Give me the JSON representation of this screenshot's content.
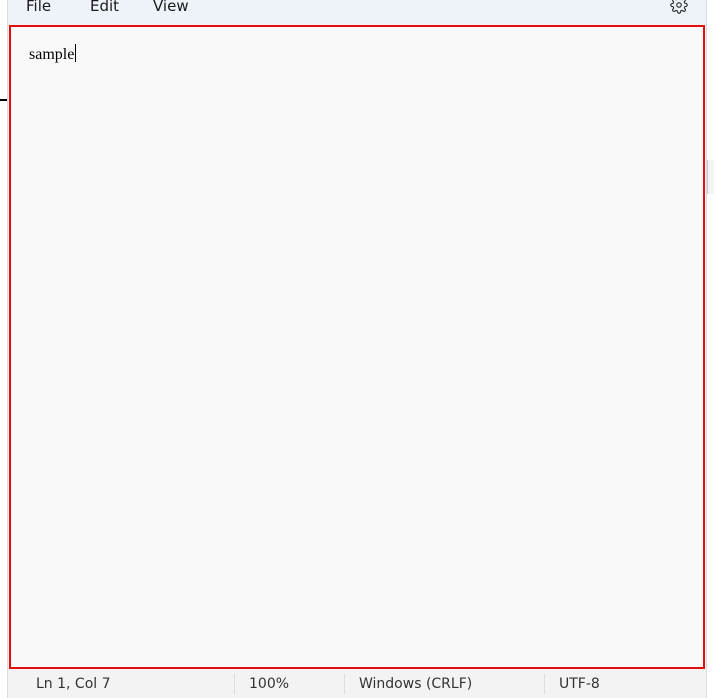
{
  "menubar": {
    "items": [
      {
        "label": "File"
      },
      {
        "label": "Edit"
      },
      {
        "label": "View"
      }
    ],
    "settings_icon": "gear-icon"
  },
  "editor": {
    "content": "sample",
    "border_color": "#e01010",
    "background": "#f9f9f9"
  },
  "statusbar": {
    "position": "Ln 1, Col 7",
    "zoom": "100%",
    "line_ending": "Windows (CRLF)",
    "encoding": "UTF-8"
  }
}
